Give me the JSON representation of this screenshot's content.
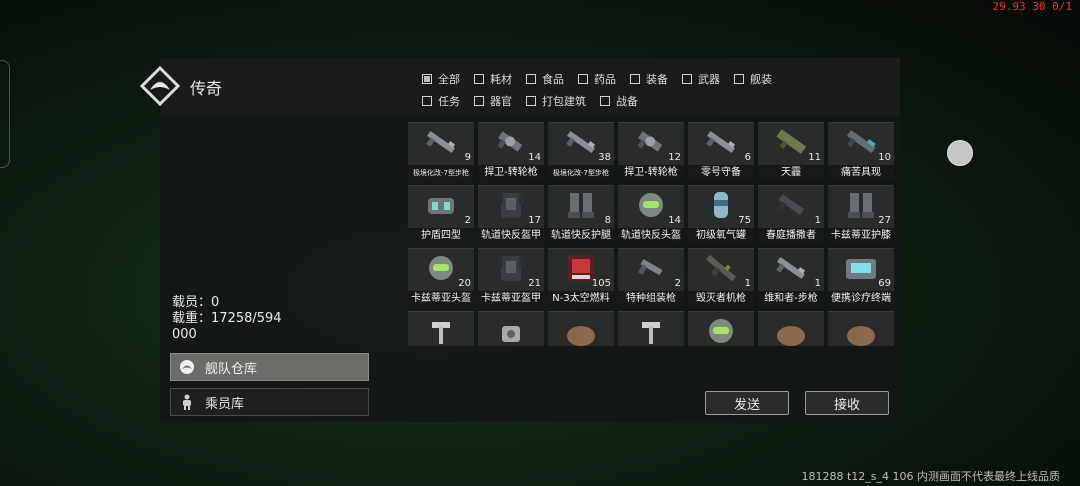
{
  "overlay": {
    "fps_text": "29.93 30 0/1",
    "build_text": "181288 t12_s_4 106 内测画面不代表最终上线品质"
  },
  "header": {
    "title": "传奇",
    "logo_icon": "diamond-emblem-icon"
  },
  "filters": {
    "row1": [
      {
        "label": "全部",
        "checked": true
      },
      {
        "label": "耗材",
        "checked": false
      },
      {
        "label": "食品",
        "checked": false
      },
      {
        "label": "药品",
        "checked": false
      },
      {
        "label": "装备",
        "checked": false
      },
      {
        "label": "武器",
        "checked": false
      },
      {
        "label": "舰装",
        "checked": false
      }
    ],
    "row2": [
      {
        "label": "任务",
        "checked": false
      },
      {
        "label": "器官",
        "checked": false
      },
      {
        "label": "打包建筑",
        "checked": false
      },
      {
        "label": "战备",
        "checked": false
      }
    ]
  },
  "stats": {
    "crew_line": "载员：0",
    "load_line1": "载重：17258/594",
    "load_line2": "000"
  },
  "side": {
    "fleet_label": "舰队仓库",
    "fleet_icon": "fleet-emblem-icon",
    "crew_label": "乘员库",
    "crew_icon": "crew-figure-icon"
  },
  "items": [
    {
      "name": "极境化改-7型步枪",
      "qty": "9",
      "icon": "rifle-icon"
    },
    {
      "name": "捍卫-转轮枪",
      "qty": "14",
      "icon": "revolver-gun-icon"
    },
    {
      "name": "极境化改-7型步枪",
      "qty": "38",
      "icon": "rifle-icon"
    },
    {
      "name": "捍卫-转轮枪",
      "qty": "12",
      "icon": "revolver-gun-icon"
    },
    {
      "name": "零号守备",
      "qty": "6",
      "icon": "rifle-icon"
    },
    {
      "name": "天霾",
      "qty": "11",
      "icon": "launcher-icon"
    },
    {
      "name": "痛苦具现",
      "qty": "10",
      "icon": "heavy-gun-icon"
    },
    {
      "name": "护盾四型",
      "qty": "2",
      "icon": "shield-module-icon"
    },
    {
      "name": "轨道快反盔甲",
      "qty": "17",
      "icon": "body-armor-icon"
    },
    {
      "name": "轨道快反护腿",
      "qty": "8",
      "icon": "leg-armor-icon"
    },
    {
      "name": "轨道快反头盔",
      "qty": "14",
      "icon": "helmet-icon"
    },
    {
      "name": "初级氧气罐",
      "qty": "75",
      "icon": "oxygen-tank-icon"
    },
    {
      "name": "春庭播撒者",
      "qty": "1",
      "icon": "sprayer-gun-icon"
    },
    {
      "name": "卡兹蒂亚护膝",
      "qty": "27",
      "icon": "leg-armor-icon"
    },
    {
      "name": "卡兹蒂亚头盔",
      "qty": "20",
      "icon": "helmet-icon"
    },
    {
      "name": "卡兹蒂亚盔甲",
      "qty": "21",
      "icon": "body-armor-icon"
    },
    {
      "name": "N-3太空燃料",
      "qty": "105",
      "icon": "fuel-cell-icon"
    },
    {
      "name": "特种组装枪",
      "qty": "2",
      "icon": "pistol-icon"
    },
    {
      "name": "毁灭者机枪",
      "qty": "1",
      "icon": "machine-gun-icon"
    },
    {
      "name": "维和者-步枪",
      "qty": "1",
      "icon": "rifle-icon"
    },
    {
      "name": "便携诊疗终端",
      "qty": "69",
      "icon": "medical-terminal-icon"
    }
  ],
  "partial_row_icons": [
    "skeleton-part-icon",
    "mech-part-icon",
    "ore-icon",
    "skeleton-part-icon",
    "helmet-icon",
    "ore-icon",
    "ore-icon"
  ],
  "buttons": {
    "send": "发送",
    "receive": "接收"
  }
}
